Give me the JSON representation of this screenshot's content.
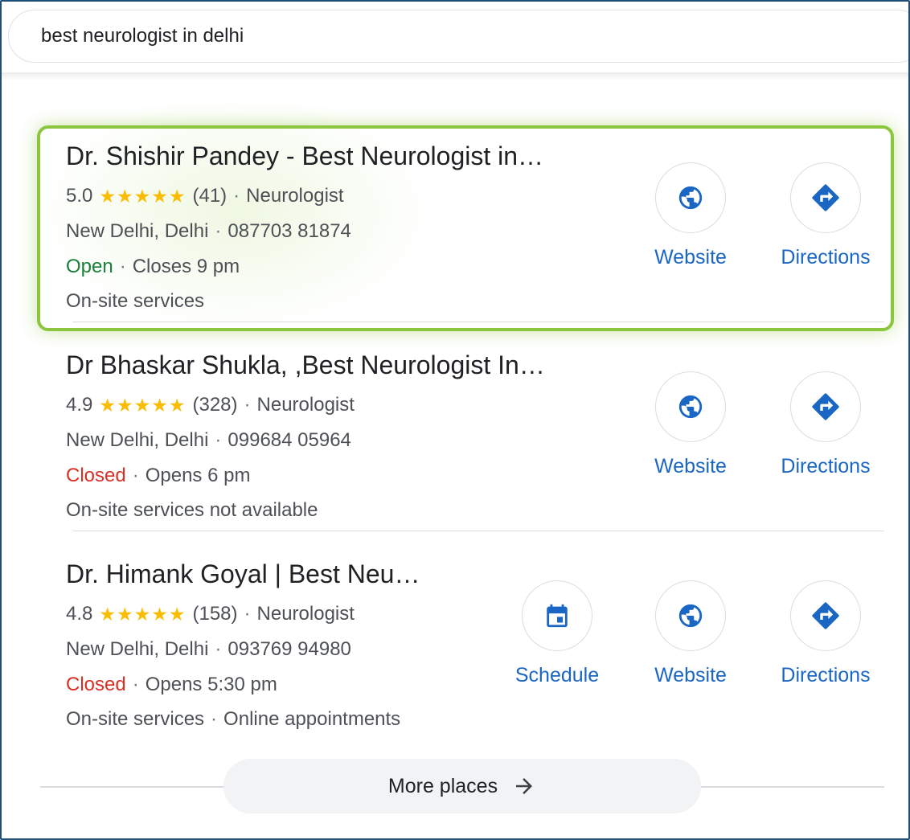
{
  "search": {
    "query": "best neurologist in delhi"
  },
  "results": [
    {
      "name": "Dr. Shishir Pandey - Best Neurologist in…",
      "rating": "5.0",
      "stars": "★★★★★",
      "reviews": "(41)",
      "category": "Neurologist",
      "location": "New Delhi, Delhi",
      "phone": "087703 81874",
      "status": "Open",
      "hours": "Closes 9 pm",
      "services": "On-site services",
      "services_extra": "",
      "actions": {
        "website": "Website",
        "directions": "Directions"
      }
    },
    {
      "name": "Dr Bhaskar Shukla, ,Best Neurologist In…",
      "rating": "4.9",
      "stars": "★★★★★",
      "reviews": "(328)",
      "category": "Neurologist",
      "location": "New Delhi, Delhi",
      "phone": "099684 05964",
      "status": "Closed",
      "hours": "Opens 6 pm",
      "services": "On-site services not available",
      "services_extra": "",
      "actions": {
        "website": "Website",
        "directions": "Directions"
      }
    },
    {
      "name": "Dr. Himank Goyal | Best Neu…",
      "rating": "4.8",
      "stars": "★★★★★",
      "reviews": "(158)",
      "category": "Neurologist",
      "location": "New Delhi, Delhi",
      "phone": "093769 94980",
      "status": "Closed",
      "hours": "Opens 5:30 pm",
      "services": "On-site services",
      "services_extra": "Online appointments",
      "actions": {
        "schedule": "Schedule",
        "website": "Website",
        "directions": "Directions"
      }
    }
  ],
  "more_places": "More places",
  "colors": {
    "accent": "#1a66c4",
    "open": "#188038",
    "closed": "#d93025",
    "star": "#fbbc04",
    "highlight": "#8cc63f"
  }
}
